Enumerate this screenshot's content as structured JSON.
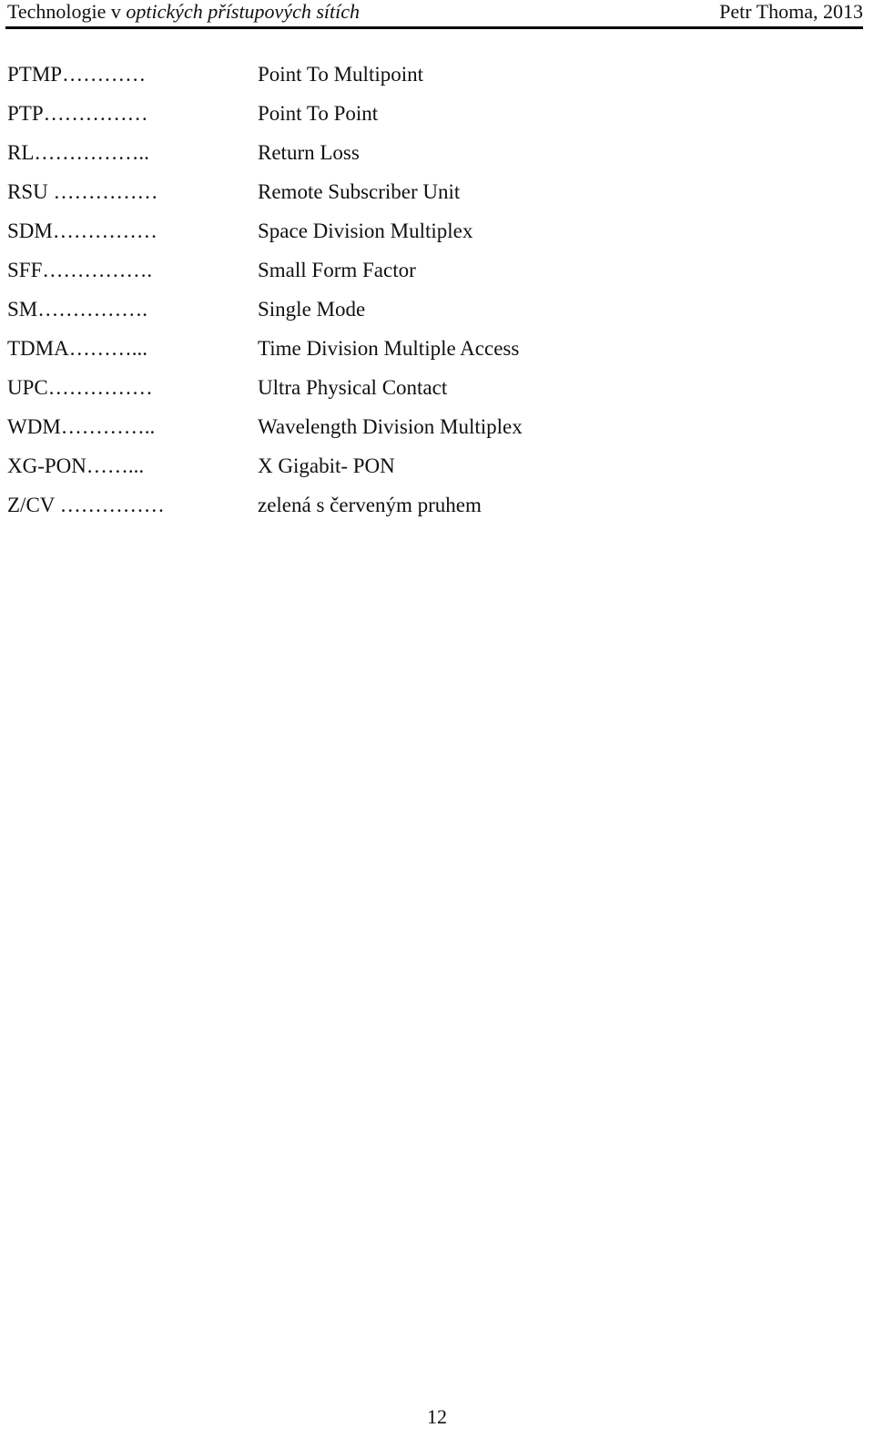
{
  "header": {
    "title_prefix": "Technologie v ",
    "title_italic": "optických přístupových sítích",
    "author_year": "Petr Thoma, 2013"
  },
  "abbreviations": [
    {
      "term": "PTMP…………",
      "definition": "Point To Multipoint"
    },
    {
      "term": "PTP……………",
      "definition": "Point To Point"
    },
    {
      "term": "RL……………..",
      "definition": "Return Loss"
    },
    {
      "term": "RSU ……………",
      "definition": "Remote Subscriber Unit"
    },
    {
      "term": "SDM……………",
      "definition": "Space Division Multiplex"
    },
    {
      "term": "SFF…………….",
      "definition": "Small Form Factor"
    },
    {
      "term": "SM…………….",
      "definition": "Single Mode"
    },
    {
      "term": "TDMA………...",
      "definition": "Time Division Multiple Access"
    },
    {
      "term": "UPC……………",
      "definition": "Ultra Physical Contact"
    },
    {
      "term": "WDM…………..",
      "definition": "Wavelength Division Multiplex"
    },
    {
      "term": "XG-PON……...",
      "definition": "X Gigabit- PON"
    },
    {
      "term": "Z/CV ……………",
      "definition": "zelená s červeným pruhem"
    }
  ],
  "footer": {
    "page_number": "12"
  }
}
